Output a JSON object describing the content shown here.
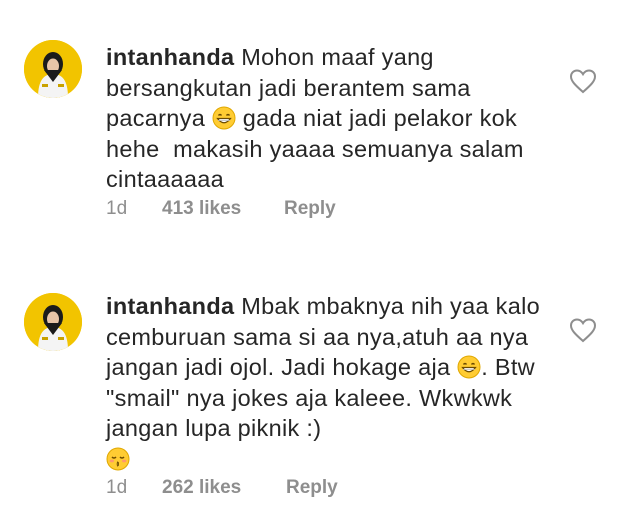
{
  "comments": [
    {
      "username": "intanhanda",
      "text_1": "Mohon maaf yang bersangkutan jadi berantem sama pacarnya ",
      "emoji_1": "grinning-face-with-smiling-eyes",
      "text_2": " gada niat jadi pelakor kok hehe  makasih yaaaa semuanya salam cintaaaaaa",
      "time": "1d",
      "likes": "413 likes",
      "reply_label": "Reply"
    },
    {
      "username": "intanhanda",
      "text_1": "Mbak mbaknya nih yaa kalo cemburuan sama si aa nya,atuh aa nya jangan jadi ojol. Jadi hokage aja ",
      "emoji_1": "grinning-face-with-smiling-eyes",
      "text_2": ". Btw \"smail\" nya jokes aja kaleee. Wkwkwk jangan lupa piknik :)",
      "emoji_2": "kissing-face-with-closed-eyes",
      "time": "1d",
      "likes": "262 likes",
      "reply_label": "Reply"
    }
  ],
  "colors": {
    "text": "#262626",
    "meta": "#8e8e8e",
    "avatar_bg": "#f2c400",
    "emoji": "#ffcc33"
  },
  "icons": {
    "like": "heart-outline-icon"
  }
}
